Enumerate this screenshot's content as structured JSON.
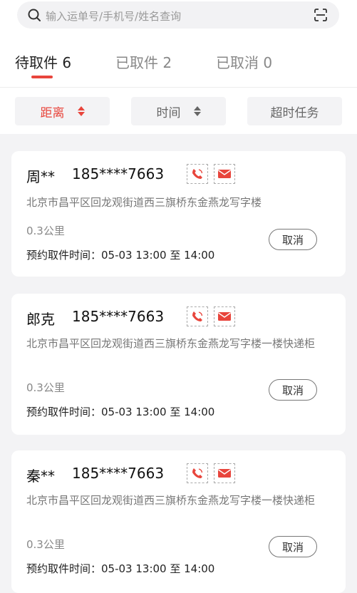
{
  "search": {
    "placeholder": "输入运单号/手机号/姓名查询",
    "left_icon": "search-icon",
    "right_icon": "scan-icon"
  },
  "tabs": [
    {
      "label": "待取件 6",
      "active": true
    },
    {
      "label": "已取件 2",
      "active": false
    },
    {
      "label": "已取消 0",
      "active": false
    }
  ],
  "filters": [
    {
      "label": "距离",
      "active": true,
      "icon": "sort-icon"
    },
    {
      "label": "时间",
      "active": false,
      "icon": "sort-icon"
    },
    {
      "label": "超时任务",
      "active": false
    }
  ],
  "colors": {
    "accent": "#e8453c",
    "background": "#f3f3f5"
  },
  "orders": [
    {
      "name": "周**",
      "phone": "185****7663",
      "call_icon": "phone-icon",
      "message_icon": "mail-icon",
      "address": "北京市昌平区回龙观街道西三旗桥东金燕龙写字楼",
      "distance": "0.3公里",
      "pickup_time": "预约取件时间：05-03 13:00 至 14:00",
      "cancel_label": "取消"
    },
    {
      "name": "郎克",
      "phone": "185****7663",
      "call_icon": "phone-icon",
      "message_icon": "mail-icon",
      "address": "北京市昌平区回龙观街道西三旗桥东金燕龙写字楼一楼快递柜",
      "distance": "0.3公里",
      "pickup_time": "预约取件时间：05-03 13:00 至 14:00",
      "cancel_label": "取消"
    },
    {
      "name": "秦**",
      "phone": "185****7663",
      "call_icon": "phone-icon",
      "message_icon": "mail-icon",
      "address": "北京市昌平区回龙观街道西三旗桥东金燕龙写字楼一楼快递柜",
      "distance": "0.3公里",
      "pickup_time": "预约取件时间：05-03 13:00 至 14:00",
      "cancel_label": "取消"
    }
  ]
}
